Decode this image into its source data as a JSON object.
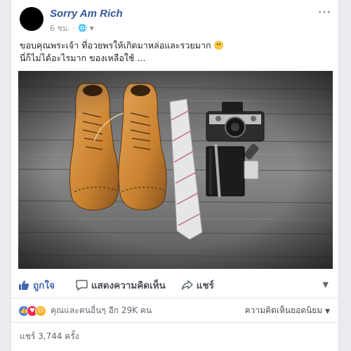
{
  "post": {
    "author": "Sorry Am Rich",
    "time": "6 ชม.",
    "privacy_icon": "globe-icon",
    "text_line1": "ขอบคุณพระเจ้า ที่อวยพรให้เกิดมาหล่อและรวยมาก",
    "text_line2": "นี่ก็ไม่ได้อะไรมาก ของเหลือใช้ ...",
    "photo_alt": "boots-tie-camera-notebook-photo"
  },
  "actions": {
    "like": "ถูกใจ",
    "comment": "แสดงความคิดเห็น",
    "share": "แชร์"
  },
  "reactions": {
    "summary": "คุณและคนอื่นๆ อีก 29K คน",
    "sort": "ความคิดเห็นยอดนิยม",
    "types": [
      "like",
      "love",
      "sad"
    ]
  },
  "shares": "แชร์ 3,744 ครั้ง",
  "colors": {
    "link": "#365899",
    "like_blue": "#4267b2",
    "meta_gray": "#90949c"
  }
}
